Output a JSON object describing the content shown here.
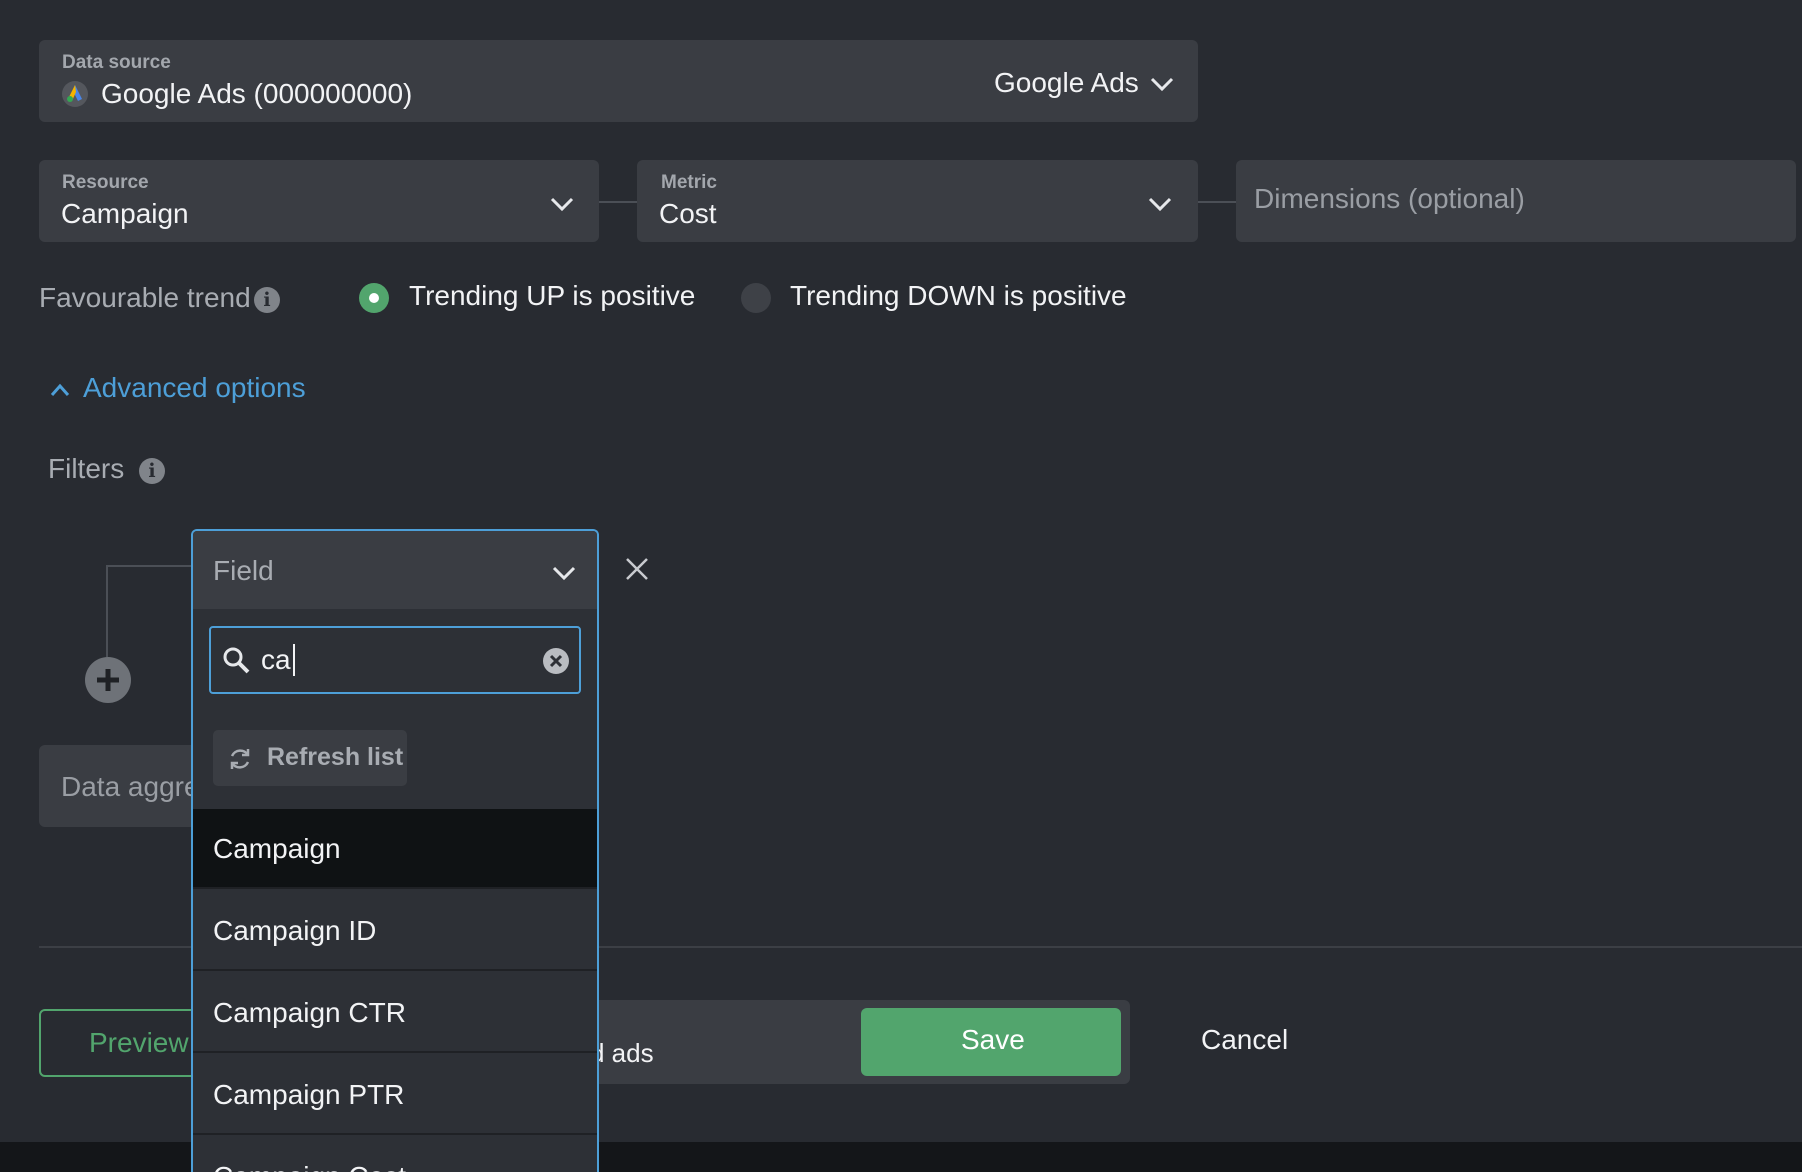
{
  "data_source": {
    "label": "Data source",
    "value": "Google Ads (000000000)",
    "provider": "Google Ads"
  },
  "resource": {
    "label": "Resource",
    "value": "Campaign"
  },
  "metric": {
    "label": "Metric",
    "value": "Cost"
  },
  "dimensions": {
    "placeholder": "Dimensions (optional)"
  },
  "trend": {
    "label": "Favourable trend",
    "up": "Trending UP is positive",
    "down": "Trending DOWN is positive",
    "selected": "up"
  },
  "advanced": {
    "label": "Advanced options"
  },
  "filters": {
    "label": "Filters"
  },
  "field_dropdown": {
    "placeholder": "Field",
    "search_value": "ca",
    "refresh_label": "Refresh list",
    "options": [
      "Campaign",
      "Campaign ID",
      "Campaign CTR",
      "Campaign PTR",
      "Campaign Cost"
    ]
  },
  "aggregation": {
    "placeholder_partial": "Data aggre"
  },
  "footer": {
    "preview_partial": "Preview",
    "toggle_partial_text": "d ads",
    "save": "Save",
    "cancel": "Cancel"
  },
  "colors": {
    "accent_blue": "#4d9fd8",
    "accent_green": "#52a56d",
    "bg": "#282b31",
    "field_bg": "#3a3d43"
  },
  "icons": [
    "google-ads-logo-icon",
    "chevron-down-icon",
    "info-icon",
    "chevron-up-icon",
    "close-icon",
    "plus-circle-icon",
    "search-icon",
    "clear-circle-icon",
    "refresh-icon"
  ]
}
